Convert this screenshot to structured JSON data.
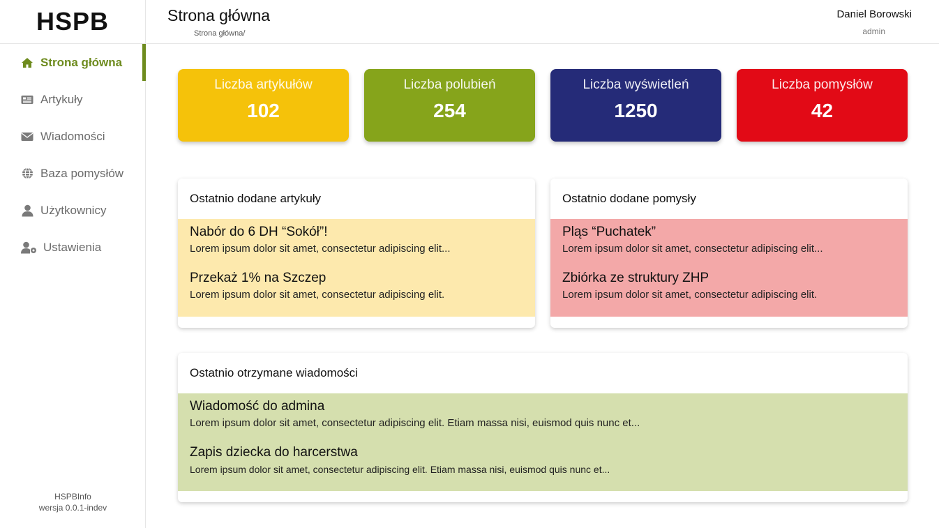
{
  "app": {
    "logo": "HSPB"
  },
  "sidebar": {
    "items": [
      {
        "label": "Strona główna",
        "icon": "home-icon",
        "active": true
      },
      {
        "label": "Artykuły",
        "icon": "newspaper-icon"
      },
      {
        "label": "Wiadomości",
        "icon": "envelope-icon"
      },
      {
        "label": "Baza pomysłów",
        "icon": "globe-icon"
      },
      {
        "label": "Użytkownicy",
        "icon": "user-icon"
      },
      {
        "label": "Ustawienia",
        "icon": "user-settings-icon"
      }
    ],
    "footer": {
      "app_name": "HSPBInfo",
      "version": "wersja 0.0.1-indev"
    }
  },
  "header": {
    "title": "Strona główna",
    "breadcrumb": "Strona główna/",
    "user": {
      "name": "Daniel Borowski",
      "role": "admin"
    }
  },
  "stats": [
    {
      "label": "Liczba artykułów",
      "value": "102",
      "color": "#f5c20a"
    },
    {
      "label": "Liczba polubień",
      "value": "254",
      "color": "#86a41b"
    },
    {
      "label": "Liczba wyświetleń",
      "value": "1250",
      "color": "#252b78"
    },
    {
      "label": "Liczba pomysłów",
      "value": "42",
      "color": "#e20a16"
    }
  ],
  "recent_articles": {
    "title": "Ostatnio dodane artykuły",
    "items": [
      {
        "title": "Nabór do 6 DH “Sokół”!",
        "text": "Lorem ipsum dolor sit amet, consectetur adipiscing elit..."
      },
      {
        "title": "Przekaż 1% na Szczep",
        "text": "Lorem ipsum dolor sit amet, consectetur adipiscing elit."
      }
    ]
  },
  "recent_ideas": {
    "title": "Ostatnio dodane pomysły",
    "items": [
      {
        "title": "Pląs “Puchatek”",
        "text": "Lorem ipsum dolor sit amet, consectetur adipiscing elit..."
      },
      {
        "title": "Zbiórka ze struktury ZHP",
        "text": "Lorem ipsum dolor sit amet, consectetur adipiscing elit."
      }
    ]
  },
  "recent_messages": {
    "title": "Ostatnio otrzymane wiadomości",
    "items": [
      {
        "title": "Wiadomość do admina",
        "text": "Lorem ipsum dolor sit amet, consectetur adipiscing elit. Etiam massa  nisi, euismod quis nunc et..."
      },
      {
        "title": "Zapis dziecka do harcerstwa",
        "text": "Lorem ipsum dolor sit amet, consectetur adipiscing elit. Etiam massa  nisi, euismod quis nunc et..."
      }
    ]
  },
  "colors": {
    "accent": "#6e8b1e",
    "articles_bg": "#fde9ad",
    "ideas_bg": "#f3a8a8",
    "messages_bg": "#d5dfae"
  }
}
